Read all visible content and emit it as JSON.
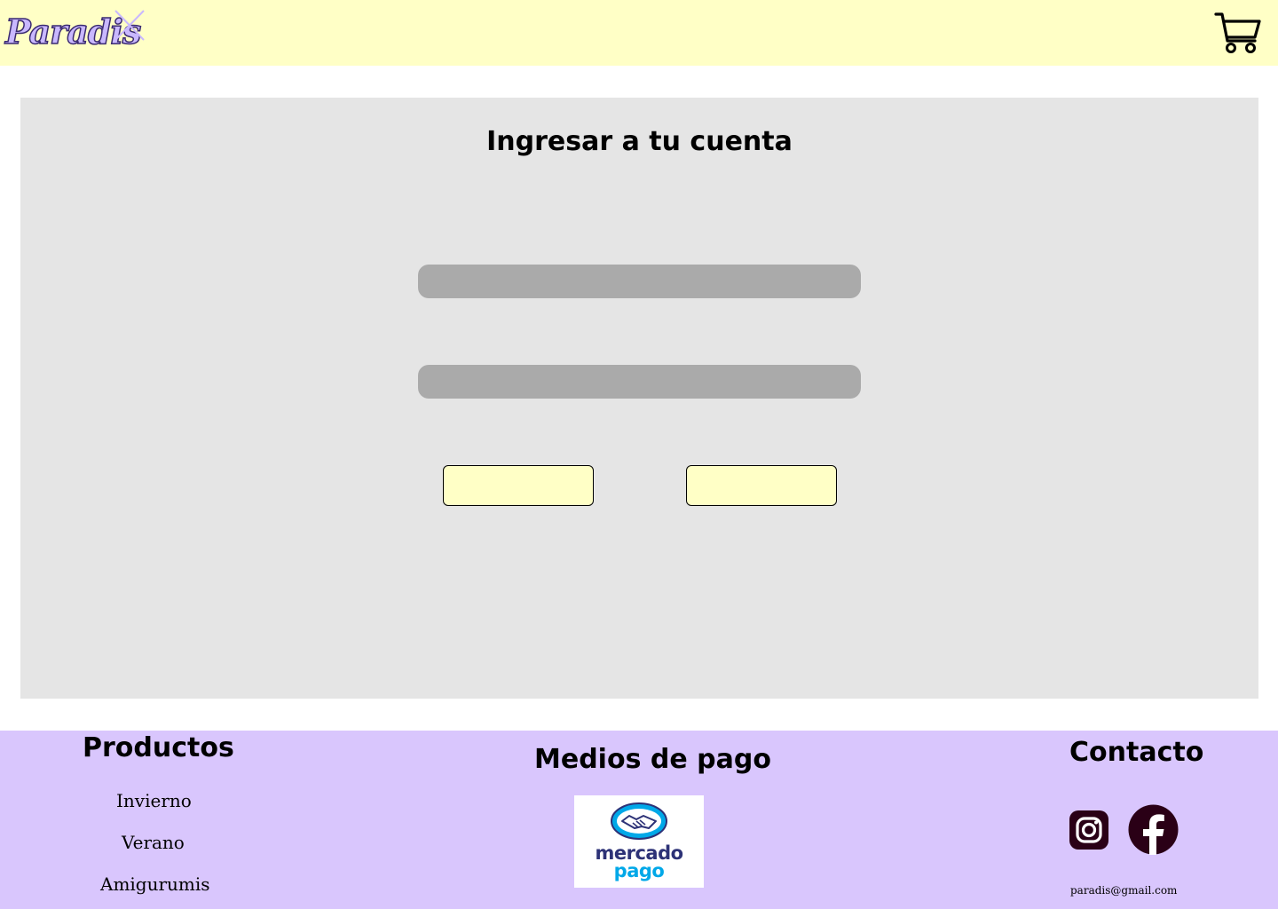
{
  "header": {
    "logo_text": "Paradis",
    "logo_x_icon": "close-icon",
    "cart_icon": "cart-icon",
    "background": "#ffffc6",
    "logo_color": "#c9b8ff"
  },
  "login": {
    "title": "Ingresar a tu cuenta",
    "user_field": {
      "value": "",
      "placeholder": ""
    },
    "password_field": {
      "value": "",
      "placeholder": ""
    },
    "login_button_label": "",
    "register_button_label": "",
    "card_background": "#e5e5e5",
    "field_color": "#aaaaaa",
    "button_color": "#ffffc6"
  },
  "footer": {
    "background": "#d9c6fd",
    "productos": {
      "heading": "Productos",
      "links": [
        "Invierno",
        "Verano",
        "Amigurumis"
      ]
    },
    "payment": {
      "heading": "Medios de pago",
      "logo_line1": "mercado",
      "logo_line2": "pago"
    },
    "contact": {
      "heading": "Contacto",
      "icons": [
        "instagram-icon",
        "facebook-icon"
      ],
      "email": "paradis@gmail.com"
    }
  }
}
